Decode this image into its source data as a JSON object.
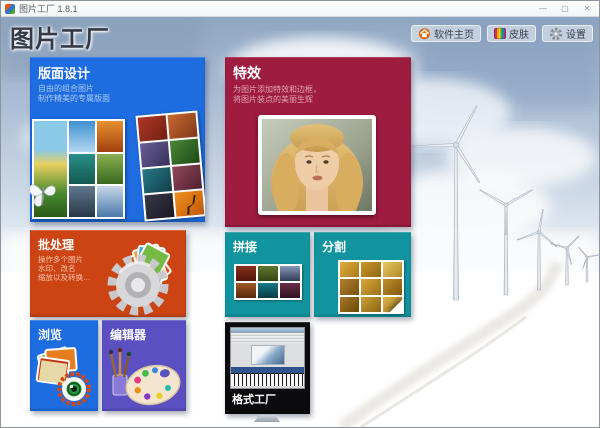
{
  "window": {
    "title": "图片工厂 1.8.1",
    "controls": {
      "minimize": "—",
      "maximize": "▢",
      "close": "✕"
    }
  },
  "header": {
    "logo": "图片工厂",
    "buttons": [
      {
        "label": "软件主页",
        "icon": "home-icon"
      },
      {
        "label": "皮肤",
        "icon": "skin-icon"
      },
      {
        "label": "设置",
        "icon": "gear-icon"
      }
    ]
  },
  "tiles": {
    "layout": {
      "title": "版面设计",
      "subtitle1": "自由的组合图片",
      "subtitle2": "制作精美的专属版面",
      "color": "#1d6ce0"
    },
    "effects": {
      "title": "特效",
      "subtitle1": "为图片添加特效和边框，",
      "subtitle2": "将图片装点的美丽生辉",
      "color": "#9e1c40"
    },
    "batch": {
      "title": "批处理",
      "subtitle1": "操作多个图片",
      "subtitle2": "水印、改名",
      "subtitle3": "缩放以及转换…",
      "color": "#cc4414"
    },
    "stitch": {
      "title": "拼接",
      "color": "#11949f"
    },
    "split": {
      "title": "分割",
      "color": "#11949f"
    },
    "browse": {
      "title": "浏览",
      "color": "#1d6ce0"
    },
    "editor": {
      "title": "编辑器",
      "color": "#5a50c2"
    },
    "format_factory": {
      "title": "格式工厂",
      "color": "#0b0b0d"
    }
  },
  "background": {
    "scene": "winter landscape with wind turbines",
    "sky": "#a3b7ce",
    "snow": "#ffffff"
  }
}
